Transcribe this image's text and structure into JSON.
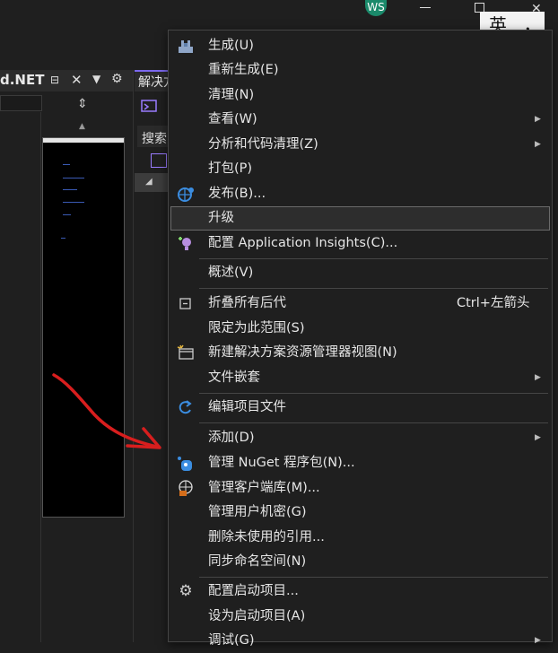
{
  "topbar": {
    "avatar": "WS",
    "ime_char": "英",
    "ime_punct": "，"
  },
  "left_panel": {
    "title": "d.NET"
  },
  "solution_explorer": {
    "tab_label": "解决方",
    "search_label": "搜索"
  },
  "colors": {
    "menu_bg": "#1f1f1f",
    "highlight_border": "#6a6a6a",
    "annotation_arrow": "#d81e1e",
    "vs_purple": "#9a7cff"
  },
  "menu": {
    "items": [
      {
        "label": "生成(U)",
        "icon": "build-icon"
      },
      {
        "label": "重新生成(E)"
      },
      {
        "label": "清理(N)"
      },
      {
        "label": "查看(W)",
        "submenu": true
      },
      {
        "label": "分析和代码清理(Z)",
        "submenu": true
      },
      {
        "label": "打包(P)"
      },
      {
        "label": "发布(B)...",
        "icon": "publish-globe-icon"
      },
      {
        "label": "升级",
        "highlighted": true
      },
      {
        "label": "配置 Application Insights(C)...",
        "icon": "app-insights-icon"
      },
      {
        "label": "概述(V)"
      },
      {
        "label": "折叠所有后代",
        "shortcut": "Ctrl+左箭头",
        "icon": "collapse-all-icon"
      },
      {
        "label": "限定为此范围(S)"
      },
      {
        "label": "新建解决方案资源管理器视图(N)",
        "icon": "new-view-icon"
      },
      {
        "label": "文件嵌套",
        "submenu": true
      },
      {
        "label": "编辑项目文件",
        "icon": "edit-project-icon"
      },
      {
        "label": "添加(D)",
        "submenu": true
      },
      {
        "label": "管理 NuGet 程序包(N)...",
        "icon": "nuget-icon"
      },
      {
        "label": "管理客户端库(M)...",
        "icon": "client-library-icon"
      },
      {
        "label": "管理用户机密(G)"
      },
      {
        "label": "删除未使用的引用..."
      },
      {
        "label": "同步命名空间(N)"
      },
      {
        "label": "配置启动项目...",
        "icon": "gear-icon"
      },
      {
        "label": "设为启动项目(A)"
      },
      {
        "label": "调试(G)",
        "submenu": true
      }
    ]
  }
}
